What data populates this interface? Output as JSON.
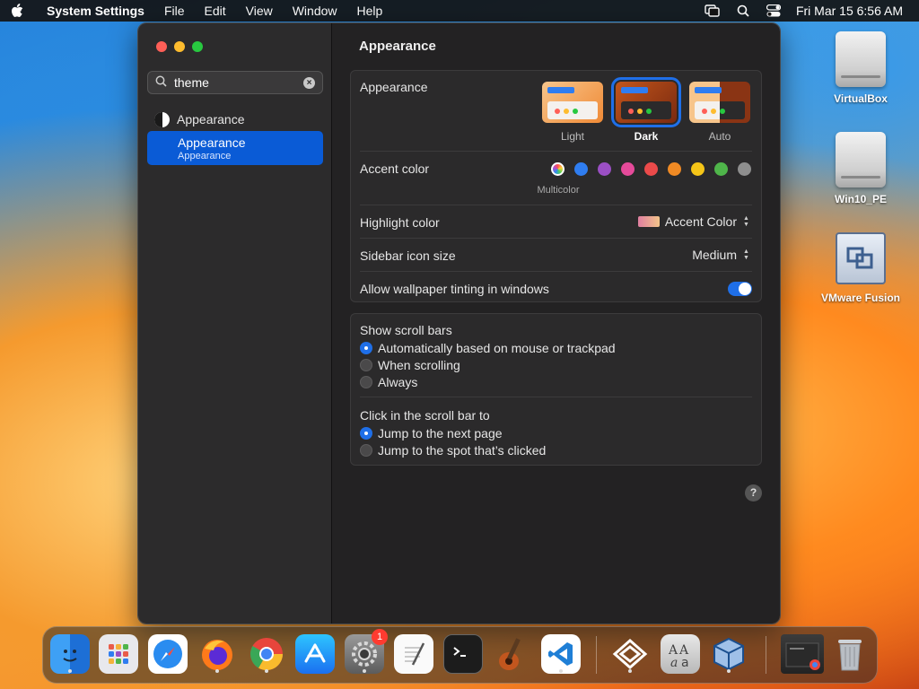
{
  "menubar": {
    "app_name": "System Settings",
    "items": [
      "File",
      "Edit",
      "View",
      "Window",
      "Help"
    ],
    "clock": "Fri Mar 15  6:56 AM"
  },
  "desktop": {
    "icons": [
      {
        "label": "VirtualBox"
      },
      {
        "label": "Win10_PE"
      },
      {
        "label": "VMware Fusion"
      }
    ]
  },
  "sidebar": {
    "search_value": "theme",
    "result_label": "Appearance",
    "selected_title": "Appearance",
    "selected_subtitle": "Appearance"
  },
  "main": {
    "title": "Appearance",
    "appearance": {
      "label": "Appearance",
      "options": [
        "Light",
        "Dark",
        "Auto"
      ],
      "selected": "Dark"
    },
    "accent": {
      "label": "Accent color",
      "selected_caption": "Multicolor",
      "colors": [
        "multicolor",
        "#2f7df0",
        "#9b4fc4",
        "#e54a9a",
        "#eb4a4a",
        "#f08a24",
        "#f5c518",
        "#4fb54a",
        "#8e8e8e"
      ]
    },
    "highlight": {
      "label": "Highlight color",
      "value": "Accent Color"
    },
    "sidebar_icon_size": {
      "label": "Sidebar icon size",
      "value": "Medium"
    },
    "wallpaper_tinting": {
      "label": "Allow wallpaper tinting in windows",
      "on": true
    },
    "scroll_bars": {
      "label": "Show scroll bars",
      "options": [
        "Automatically based on mouse or trackpad",
        "When scrolling",
        "Always"
      ],
      "selected": 0
    },
    "click_scroll": {
      "label": "Click in the scroll bar to",
      "options": [
        "Jump to the next page",
        "Jump to the spot that’s clicked"
      ],
      "selected": 0
    },
    "help": "?"
  },
  "dock": {
    "settings_badge": "1",
    "apps": [
      "finder-icon",
      "launchpad-icon",
      "safari-icon",
      "firefox-icon",
      "chrome-icon",
      "app-store-icon",
      "system-settings-icon",
      "textedit-icon",
      "terminal-icon",
      "garageband-icon",
      "vscode-icon",
      "parallels-icon",
      "font-book-icon",
      "virtualbox-icon",
      "recent-window-icon",
      "trash-icon"
    ]
  }
}
